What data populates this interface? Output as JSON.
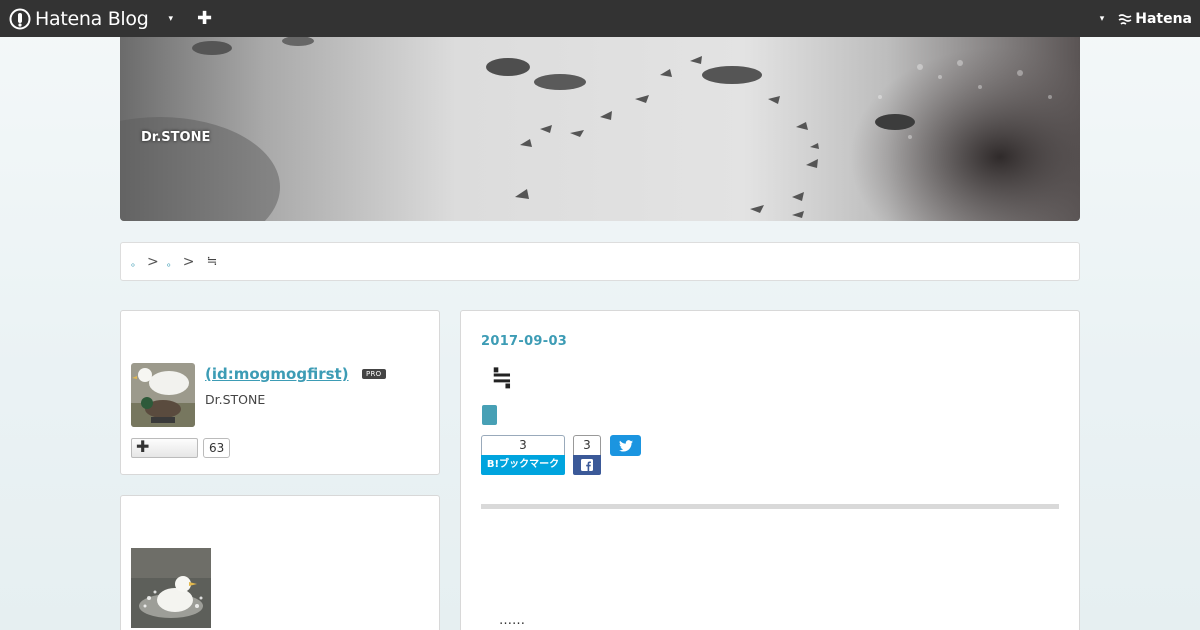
{
  "topbar": {
    "brand_name": "Hatena Blog",
    "right_logo_text": "Hatena",
    "dropdown_caret": "▾",
    "add_symbol": "✚"
  },
  "header": {
    "blog_title": "Dr.STONE"
  },
  "breadcrumb": {
    "items": [
      "。",
      "。"
    ],
    "separator": ">",
    "current": "≒"
  },
  "profile": {
    "id_text": "(id:mogmogfirst)",
    "badge": "PRO",
    "description": "Dr.STONE",
    "follow_symbol": "✚",
    "follower_count": "63"
  },
  "entry": {
    "date": "2017-09-03",
    "title": "≒",
    "bookmark_count": "3",
    "bookmark_label": "B!ブックマーク",
    "facebook_count": "3",
    "ellipsis": "……"
  },
  "colors": {
    "accent": "#3d9cb5",
    "topbar": "#333333",
    "hatena_bookmark": "#00a4de",
    "facebook": "#3b5998",
    "twitter": "#1b95e0"
  }
}
